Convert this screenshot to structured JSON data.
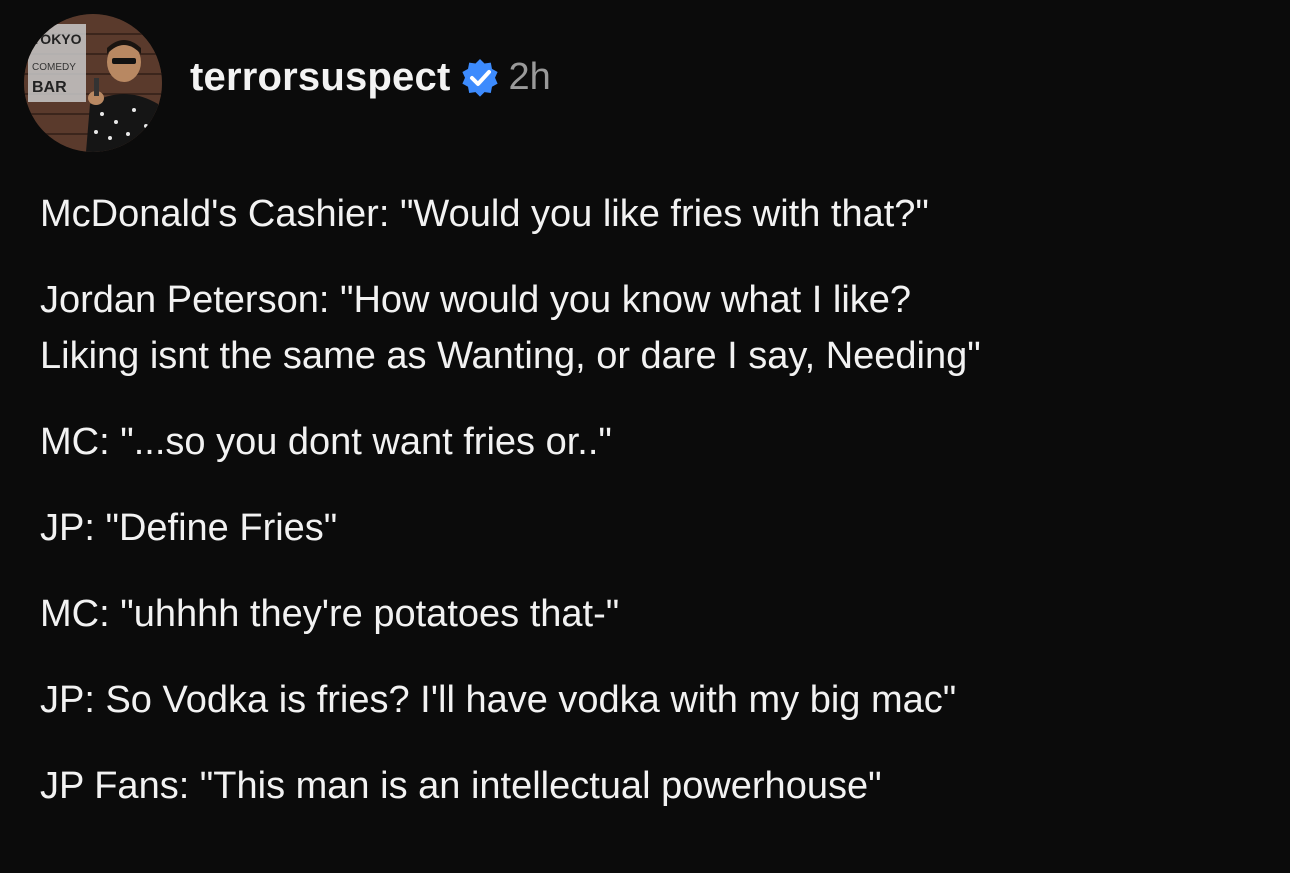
{
  "post": {
    "avatar_icon": "comedian-avatar",
    "avatar_sign_text": [
      "TOKYO",
      "COMEDY",
      "BAR"
    ],
    "username": "terrorsuspect",
    "verified_icon": "verified-badge-icon",
    "verified_color": "#3d8bfd",
    "timestamp": "2h",
    "lines": [
      "McDonald's Cashier: \"Would you like fries with that?\"",
      "Jordan Peterson: \"How would you know what I like?",
      "Liking isnt the same as Wanting, or dare I say, Needing\"",
      "MC: \"...so you dont want fries or..\"",
      "JP: \"Define Fries\"",
      "MC: \"uhhhh they're potatoes that-\"",
      "JP: So Vodka is fries? I'll have vodka with my big mac\"",
      "JP Fans: \"This man is an intellectual powerhouse\""
    ]
  }
}
